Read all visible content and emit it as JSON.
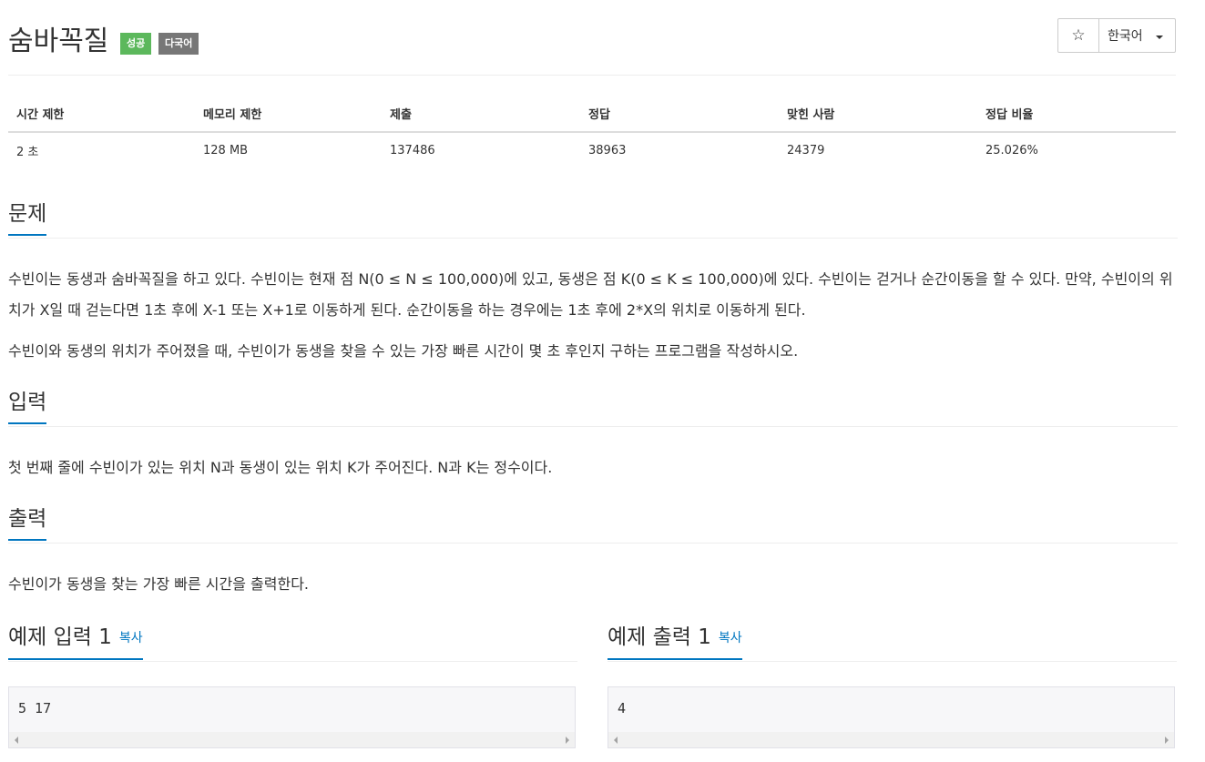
{
  "problem": {
    "title": "숨바꼭질",
    "badges": {
      "success": "성공",
      "multilang": "다국어"
    }
  },
  "actions": {
    "star": "☆",
    "language": "한국어"
  },
  "stats": {
    "headers": [
      "시간 제한",
      "메모리 제한",
      "제출",
      "정답",
      "맞힌 사람",
      "정답 비율"
    ],
    "values": [
      "2 초",
      "128 MB",
      "137486",
      "38963",
      "24379",
      "25.026%"
    ]
  },
  "sections": {
    "description": {
      "title": "문제",
      "paragraphs": [
        "수빈이는 동생과 숨바꼭질을 하고 있다. 수빈이는 현재 점 N(0 ≤ N ≤ 100,000)에 있고, 동생은 점 K(0 ≤ K ≤ 100,000)에 있다. 수빈이는 걷거나 순간이동을 할 수 있다. 만약, 수빈이의 위치가 X일 때 걷는다면 1초 후에 X-1 또는 X+1로 이동하게 된다. 순간이동을 하는 경우에는 1초 후에 2*X의 위치로 이동하게 된다.",
        "수빈이와 동생의 위치가 주어졌을 때, 수빈이가 동생을 찾을 수 있는 가장 빠른 시간이 몇 초 후인지 구하는 프로그램을 작성하시오."
      ]
    },
    "input": {
      "title": "입력",
      "text": "첫 번째 줄에 수빈이가 있는 위치 N과 동생이 있는 위치 K가 주어진다. N과 K는 정수이다."
    },
    "output": {
      "title": "출력",
      "text": "수빈이가 동생을 찾는 가장 빠른 시간을 출력한다."
    }
  },
  "samples": {
    "input": {
      "title": "예제 입력 1",
      "copy": "복사",
      "content": "5 17"
    },
    "output": {
      "title": "예제 출력 1",
      "copy": "복사",
      "content": "4"
    }
  },
  "colors": {
    "accent": "#0076c0",
    "success": "#5cb85c",
    "badge_gray": "#777777"
  }
}
